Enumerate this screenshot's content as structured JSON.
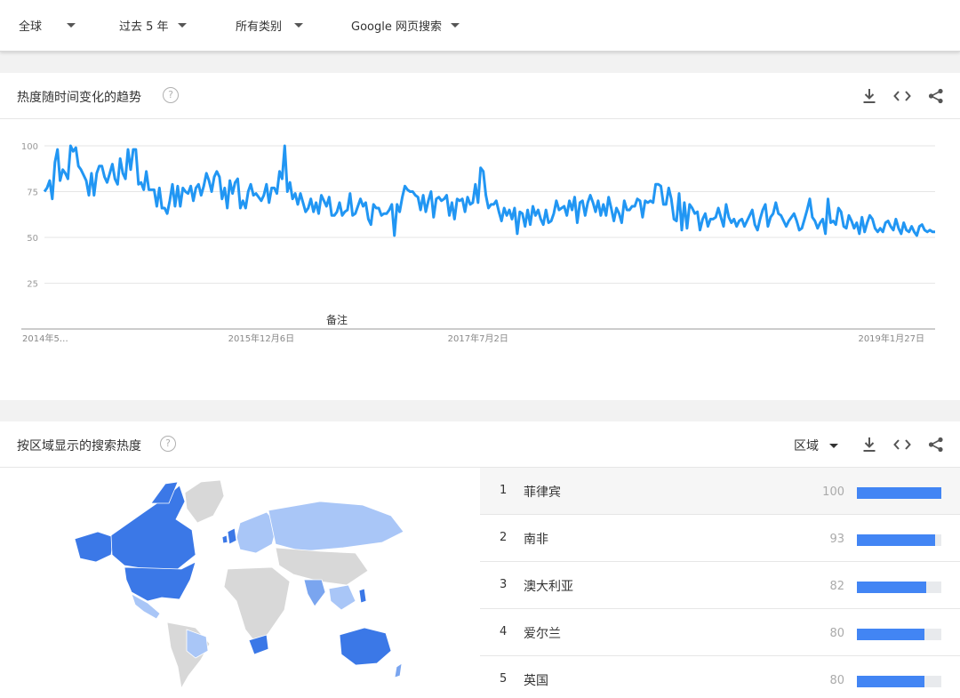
{
  "filters": {
    "geo": "全球",
    "time": "过去 5 年",
    "category": "所有类别",
    "search_type": "Google 网页搜索"
  },
  "interest_over_time": {
    "title": "热度随时间变化的趋势",
    "help_symbol": "?",
    "annotation": "备注",
    "actions": [
      "download-icon",
      "embed-icon",
      "share-icon"
    ]
  },
  "chart_data": {
    "type": "line",
    "title": "",
    "xlabel": "",
    "ylabel": "",
    "ylim": [
      0,
      100
    ],
    "y_ticks": [
      100,
      75,
      50,
      25
    ],
    "grid": true,
    "line_color": "#2196f3",
    "x_tick_labels": [
      "2014年5…",
      "2015年12月6日",
      "2017年7月2日",
      "2019年1月27日"
    ],
    "x_tick_index": [
      0,
      83,
      166,
      249
    ],
    "series": [
      {
        "values": [
          75,
          77,
          81,
          71,
          91,
          98,
          81,
          87,
          85,
          82,
          100,
          97,
          99,
          89,
          87,
          84,
          81,
          73,
          85,
          73,
          85,
          89,
          89,
          83,
          80,
          85,
          90,
          82,
          79,
          93,
          85,
          82,
          98,
          87,
          98,
          98,
          79,
          80,
          76,
          86,
          76,
          76,
          76,
          67,
          77,
          66,
          66,
          63,
          70,
          79,
          67,
          78,
          67,
          77,
          75,
          74,
          78,
          70,
          77,
          79,
          73,
          78,
          85,
          81,
          75,
          83,
          86,
          83,
          71,
          77,
          66,
          81,
          74,
          80,
          82,
          66,
          70,
          66,
          75,
          79,
          73,
          74,
          72,
          70,
          73,
          79,
          69,
          77,
          77,
          74,
          86,
          82,
          100,
          75,
          80,
          71,
          74,
          68,
          74,
          69,
          64,
          66,
          71,
          64,
          69,
          63,
          73,
          70,
          67,
          72,
          62,
          62,
          64,
          69,
          62,
          64,
          65,
          74,
          62,
          63,
          67,
          71,
          67,
          69,
          60,
          57,
          68,
          66,
          66,
          62,
          63,
          63,
          65,
          68,
          51,
          68,
          64,
          72,
          78,
          76,
          75,
          75,
          73,
          72,
          65,
          73,
          64,
          70,
          75,
          61,
          71,
          72,
          70,
          71,
          73,
          62,
          69,
          60,
          71,
          70,
          71,
          64,
          72,
          68,
          69,
          79,
          69,
          88,
          86,
          73,
          66,
          68,
          68,
          70,
          64,
          59,
          66,
          62,
          65,
          60,
          66,
          52,
          64,
          63,
          56,
          65,
          57,
          67,
          62,
          65,
          60,
          57,
          65,
          58,
          59,
          63,
          70,
          65,
          66,
          67,
          62,
          70,
          65,
          72,
          58,
          69,
          70,
          62,
          69,
          73,
          69,
          64,
          70,
          62,
          68,
          62,
          72,
          66,
          59,
          66,
          63,
          58,
          70,
          65,
          65,
          67,
          67,
          71,
          70,
          61,
          70,
          69,
          70,
          69,
          79,
          79,
          78,
          68,
          68,
          77,
          71,
          60,
          59,
          74,
          54,
          69,
          55,
          68,
          66,
          63,
          64,
          54,
          60,
          63,
          56,
          60,
          60,
          61,
          66,
          61,
          56,
          68,
          61,
          58,
          60,
          56,
          59,
          60,
          56,
          59,
          62,
          65,
          57,
          54,
          60,
          65,
          68,
          56,
          61,
          63,
          69,
          63,
          62,
          59,
          56,
          59,
          61,
          63,
          59,
          54,
          55,
          60,
          65,
          71,
          61,
          59,
          55,
          58,
          60,
          52,
          71,
          58,
          59,
          57,
          66,
          64,
          56,
          55,
          62,
          59,
          55,
          58,
          52,
          61,
          53,
          58,
          62,
          60,
          55,
          53,
          55,
          53,
          58,
          59,
          56,
          54,
          60,
          55,
          52,
          58,
          54,
          53,
          56,
          53,
          51,
          56,
          57,
          54,
          53,
          54,
          53,
          53
        ]
      }
    ]
  },
  "interest_by_region": {
    "title": "按区域显示的搜索热度",
    "help_symbol": "?",
    "resolution_label": "区域",
    "actions": [
      "download-icon",
      "embed-icon",
      "share-icon"
    ],
    "bar_color": "#4285f4",
    "rows": [
      {
        "rank": "1",
        "name": "菲律宾",
        "value": 100
      },
      {
        "rank": "2",
        "name": "南非",
        "value": 93
      },
      {
        "rank": "3",
        "name": "澳大利亚",
        "value": 82
      },
      {
        "rank": "4",
        "name": "爱尔兰",
        "value": 80
      },
      {
        "rank": "5",
        "name": "英国",
        "value": 80
      }
    ]
  },
  "map_colors": {
    "strong": "#3b78e7",
    "medium": "#7aa5ef",
    "light": "#a9c6f7",
    "none": "#d8d8d8"
  }
}
